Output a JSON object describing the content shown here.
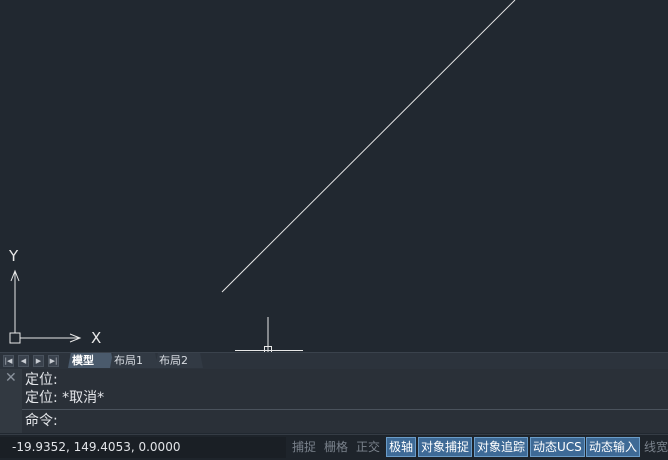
{
  "canvas": {
    "ucs_x_label": "X",
    "ucs_y_label": "Y"
  },
  "tabs": {
    "nav": [
      "first-tab-icon",
      "prev-tab-icon",
      "next-tab-icon",
      "last-tab-icon"
    ],
    "items": [
      {
        "label": "模型",
        "active": true
      },
      {
        "label": "布局1",
        "active": false
      },
      {
        "label": "布局2",
        "active": false
      }
    ]
  },
  "command": {
    "history": [
      "定位:",
      "定位: *取消*"
    ],
    "prompt": "命令:"
  },
  "status": {
    "coordinates": "-19.9352, 149.4053, 0.0000",
    "toggles": [
      {
        "label": "捕捉",
        "on": false
      },
      {
        "label": "栅格",
        "on": false
      },
      {
        "label": "正交",
        "on": false
      },
      {
        "label": "极轴",
        "on": true
      },
      {
        "label": "对象捕捉",
        "on": true
      },
      {
        "label": "对象追踪",
        "on": true
      },
      {
        "label": "动态UCS",
        "on": true
      },
      {
        "label": "动态输入",
        "on": true
      },
      {
        "label": "线宽",
        "on": false
      }
    ]
  },
  "colors": {
    "background": "#212830",
    "toggle_on": "#3e6a96"
  }
}
